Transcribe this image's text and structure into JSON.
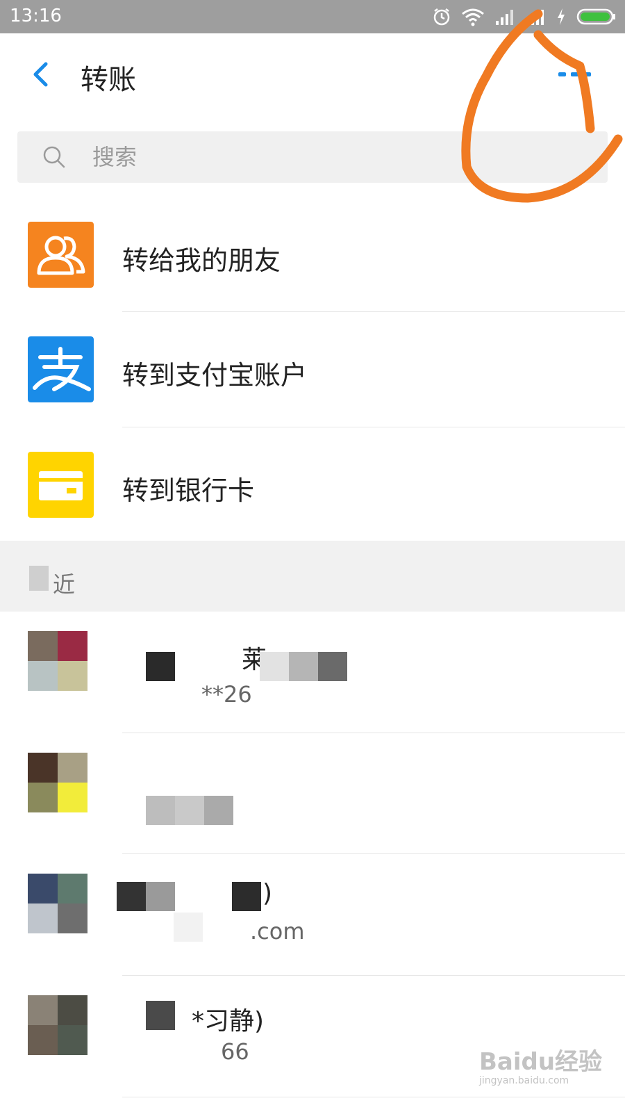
{
  "status_bar": {
    "time": "13:16",
    "battery_color": "#3ec13e",
    "icons": [
      "alarm-icon",
      "wifi-icon",
      "signal-icon",
      "signal-icon",
      "charging-icon",
      "battery-icon"
    ]
  },
  "header": {
    "back_icon": "chevron-left-icon",
    "title": "转账",
    "more_icon": "more-icon",
    "accent": "#1a8ce8"
  },
  "search": {
    "placeholder": "搜索"
  },
  "actions": [
    {
      "label": "转给我的朋友",
      "icon": "friends-icon",
      "color": "#f5841f"
    },
    {
      "label": "转到支付宝账户",
      "icon": "alipay-icon",
      "color": "#1a8ce8"
    },
    {
      "label": "转到银行卡",
      "icon": "bank-card-icon",
      "color": "#ffd400"
    }
  ],
  "recent": {
    "header": "近",
    "contacts": [
      {
        "name": "莱",
        "sub": "**26"
      },
      {
        "name": "",
        "sub": ""
      },
      {
        "name": ")",
        "sub": ".com"
      },
      {
        "name": "*习静)",
        "sub": "66"
      }
    ]
  },
  "annotation": {
    "color": "#f07a22"
  },
  "watermark": {
    "brand": "Baidu经验",
    "url": "jingyan.baidu.com"
  }
}
